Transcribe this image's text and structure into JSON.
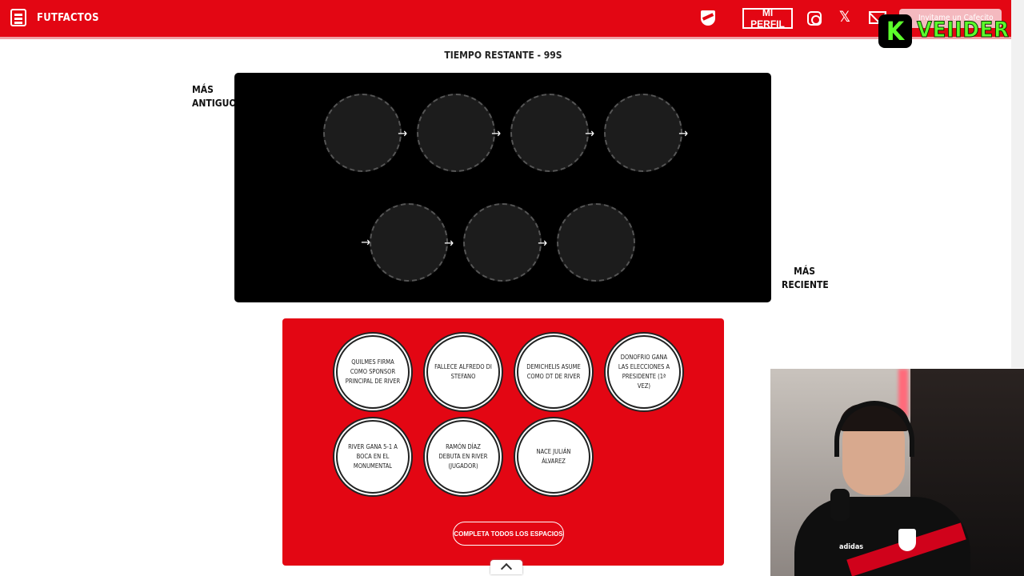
{
  "header": {
    "brand": "FUTFACTOS",
    "profile_label": "MI PERFIL",
    "cafecito_label": "Invitame un Cafecito",
    "x_glyph": "𝕏"
  },
  "overlay": {
    "k_letter": "K",
    "name": "VEIIDER"
  },
  "timer": "TIEMPO RESTANTE - 99S",
  "labels": {
    "oldest_line1": "MÁS",
    "oldest_line2": "ANTIGUO",
    "newest_line1": "MÁS",
    "newest_line2": "RECIENTE"
  },
  "arrow_glyph": "→",
  "cards": [
    "QUILMES FIRMA COMO SPONSOR PRINCIPAL DE RIVER",
    "FALLECE ALFREDO DI STEFANO",
    "DEMICHELIS ASUME COMO DT DE RIVER",
    "DONOFRIO GANA LAS ELECCIONES A PRESIDENTE (1ª VEZ)",
    "RIVER GANA 5-1 A BOCA EN EL MONUMENTAL",
    "RAMÓN DÍAZ DEBUTA EN RIVER (JUGADOR)",
    "NACE JULIÁN ÁLVAREZ"
  ],
  "complete_button": "COMPLETA TODOS LOS ESPACIOS",
  "webcam_shirt_text": "adidas",
  "colors": {
    "brand_red": "#e30613",
    "board_black": "#000000",
    "overlay_green": "#5cff2b"
  }
}
